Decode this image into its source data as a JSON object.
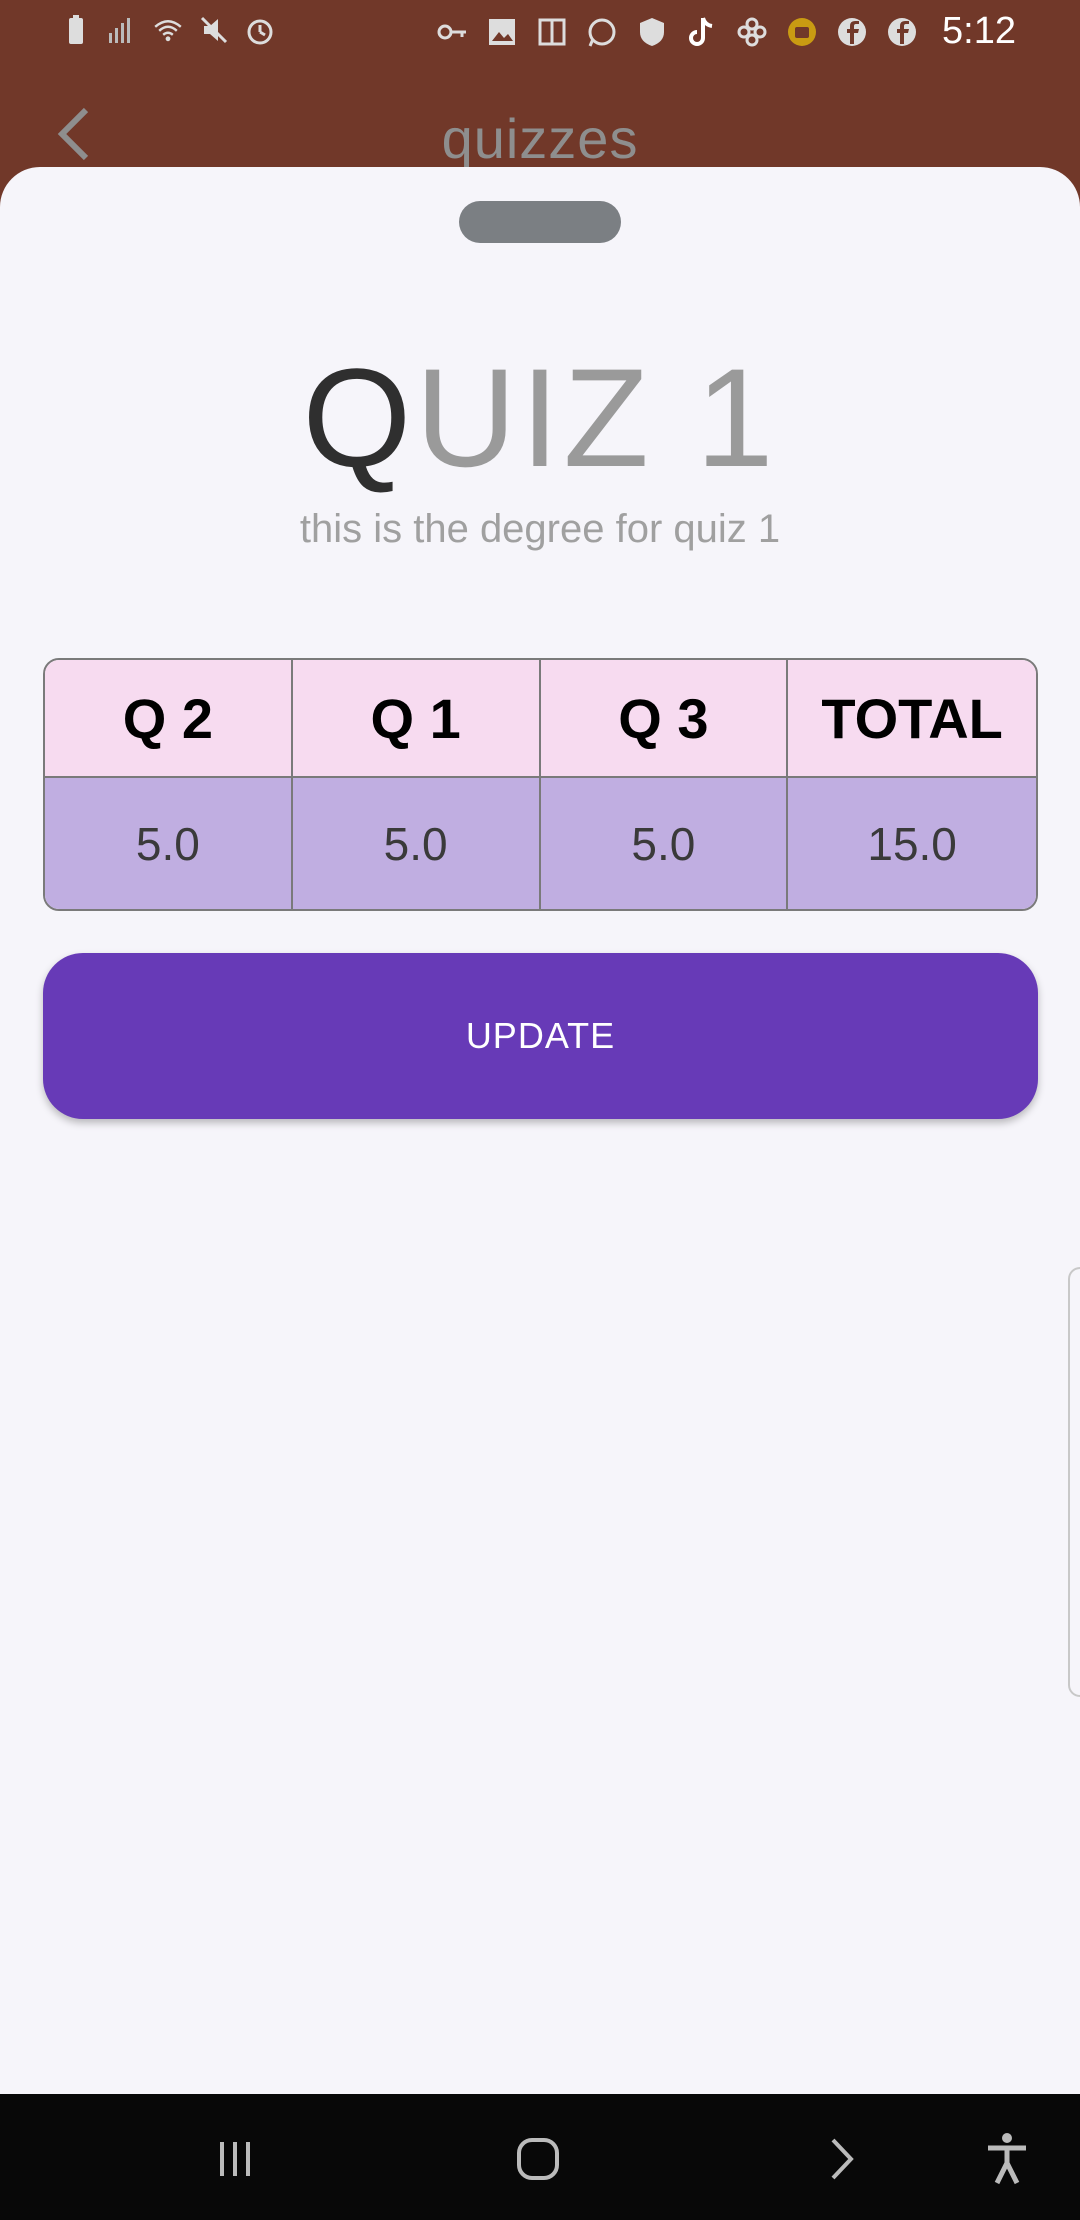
{
  "status_bar": {
    "time": "5:12",
    "left_icons": [
      "battery-icon",
      "signal-icon",
      "wifi-icon",
      "mute-icon",
      "alarm-icon"
    ],
    "right_icons": [
      "vpn-key-icon",
      "gallery-icon",
      "app-icon",
      "whatsapp-icon",
      "shield-icon",
      "tiktok-icon",
      "flower-icon",
      "download-icon",
      "facebook-icon",
      "facebook-icon"
    ]
  },
  "app_bar": {
    "title": "quizzes"
  },
  "sheet": {
    "title_first": "Q",
    "title_rest": "UIZ 1",
    "subtitle": "this is the degree for quiz 1",
    "table": {
      "headers": [
        "Q 2",
        "Q 1",
        "Q 3",
        "TOTAL"
      ],
      "values": [
        "5.0",
        "5.0",
        "5.0",
        "15.0"
      ]
    },
    "update_label": "UPDATE"
  },
  "colors": {
    "status_bg": "#713829",
    "sheet_bg": "#f6f5fa",
    "header_cell": "#f7dbf0",
    "value_cell": "#c0aee1",
    "accent": "#673ab7"
  }
}
